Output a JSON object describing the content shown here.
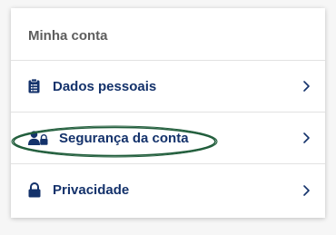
{
  "section": {
    "title": "Minha conta"
  },
  "items": [
    {
      "label": "Dados pessoais",
      "icon": "clipboard-icon"
    },
    {
      "label": "Segurança da conta",
      "icon": "user-lock-icon",
      "highlighted": true
    },
    {
      "label": "Privacidade",
      "icon": "lock-icon"
    }
  ],
  "colors": {
    "primary_text": "#14326b",
    "header_text": "#5d5d5d",
    "highlight_ring": "#1f5c3a",
    "divider": "#e2e2e2"
  }
}
